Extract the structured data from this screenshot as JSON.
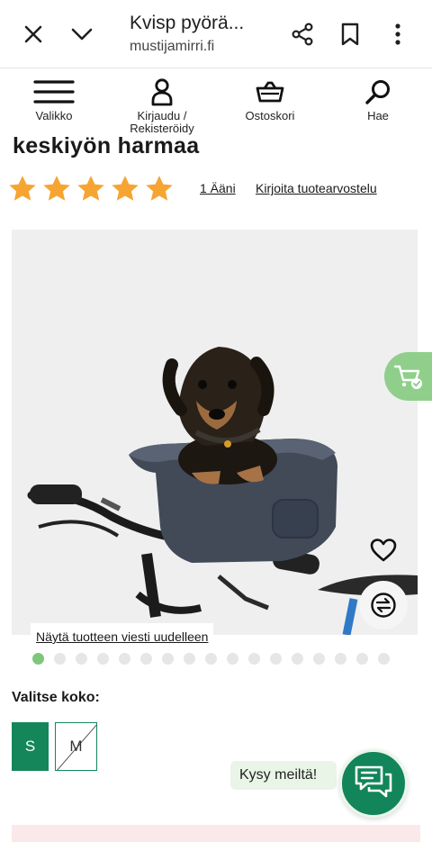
{
  "browser": {
    "title": "Kvisp pyörä...",
    "url": "mustijamirri.fi",
    "icons": [
      "close-icon",
      "chevron-down-icon",
      "share-icon",
      "bookmark-icon",
      "more-vert-icon"
    ]
  },
  "header": {
    "nav": [
      {
        "label": "Valikko",
        "icon": "hamburger-icon"
      },
      {
        "label": "Kirjaudu / Rekisteröidy",
        "icon": "user-icon"
      },
      {
        "label": "Ostoskori",
        "icon": "basket-icon"
      },
      {
        "label": "Hae",
        "icon": "search-icon"
      }
    ]
  },
  "product": {
    "title": "keskiyön harmaa",
    "rating": {
      "value": 5,
      "max": 5,
      "votes_label": "1 Ääni",
      "review_link": "Kirjoita tuotearvostelu"
    },
    "image_message": "Näytä tuotteen viesti uudelleen",
    "gallery": {
      "count": 17,
      "active": 0
    },
    "size_label": "Valitse koko:",
    "sizes": [
      {
        "label": "S",
        "selected": true,
        "available": true
      },
      {
        "label": "M",
        "selected": false,
        "available": false
      }
    ]
  },
  "chat": {
    "label": "Kysy meiltä!"
  },
  "colors": {
    "brand_green": "#14865a",
    "light_green": "#8fcf8b",
    "star": "#f6a532"
  }
}
